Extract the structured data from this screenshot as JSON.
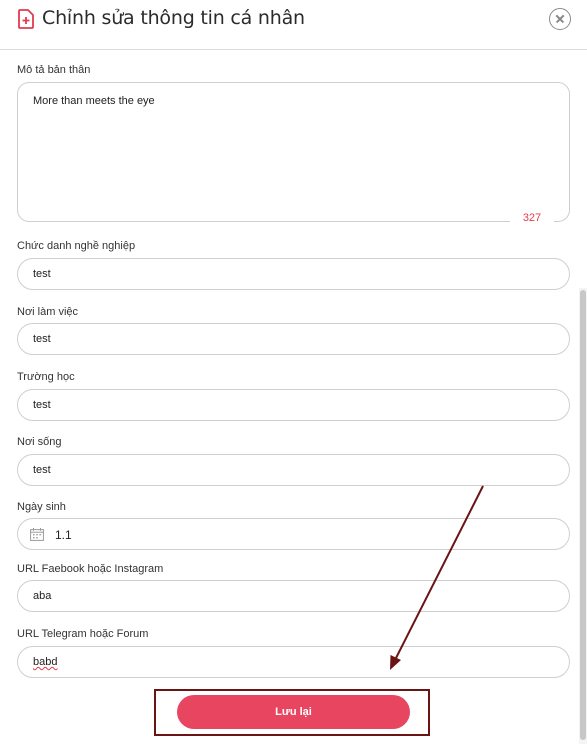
{
  "dialog": {
    "title": "Chỉnh sửa thông tin cá nhân",
    "icon": "document-plus-icon",
    "close_icon": "close-circle-icon"
  },
  "form": {
    "bio": {
      "label": "Mô tả bản thân",
      "value": "More than meets the eye",
      "char_count": "327"
    },
    "job_title": {
      "label": "Chức danh nghề nghiệp",
      "value": "test"
    },
    "workplace": {
      "label": "Nơi làm việc",
      "value": "test"
    },
    "school": {
      "label": "Trường học",
      "value": "test"
    },
    "residence": {
      "label": "Nơi sống",
      "value": "test"
    },
    "birthday": {
      "label": "Ngày sinh",
      "value": "1.1",
      "icon": "calendar-icon"
    },
    "facebook_instagram": {
      "label": "URL Faebook hoặc Instagram",
      "value": "aba"
    },
    "telegram_forum": {
      "label": "URL Telegram hoặc Forum",
      "value": "babd"
    }
  },
  "actions": {
    "save_label": "Lưu lại"
  },
  "colors": {
    "accent": "#e84560",
    "counter": "#e23b4e",
    "annotation": "#6b1414"
  }
}
